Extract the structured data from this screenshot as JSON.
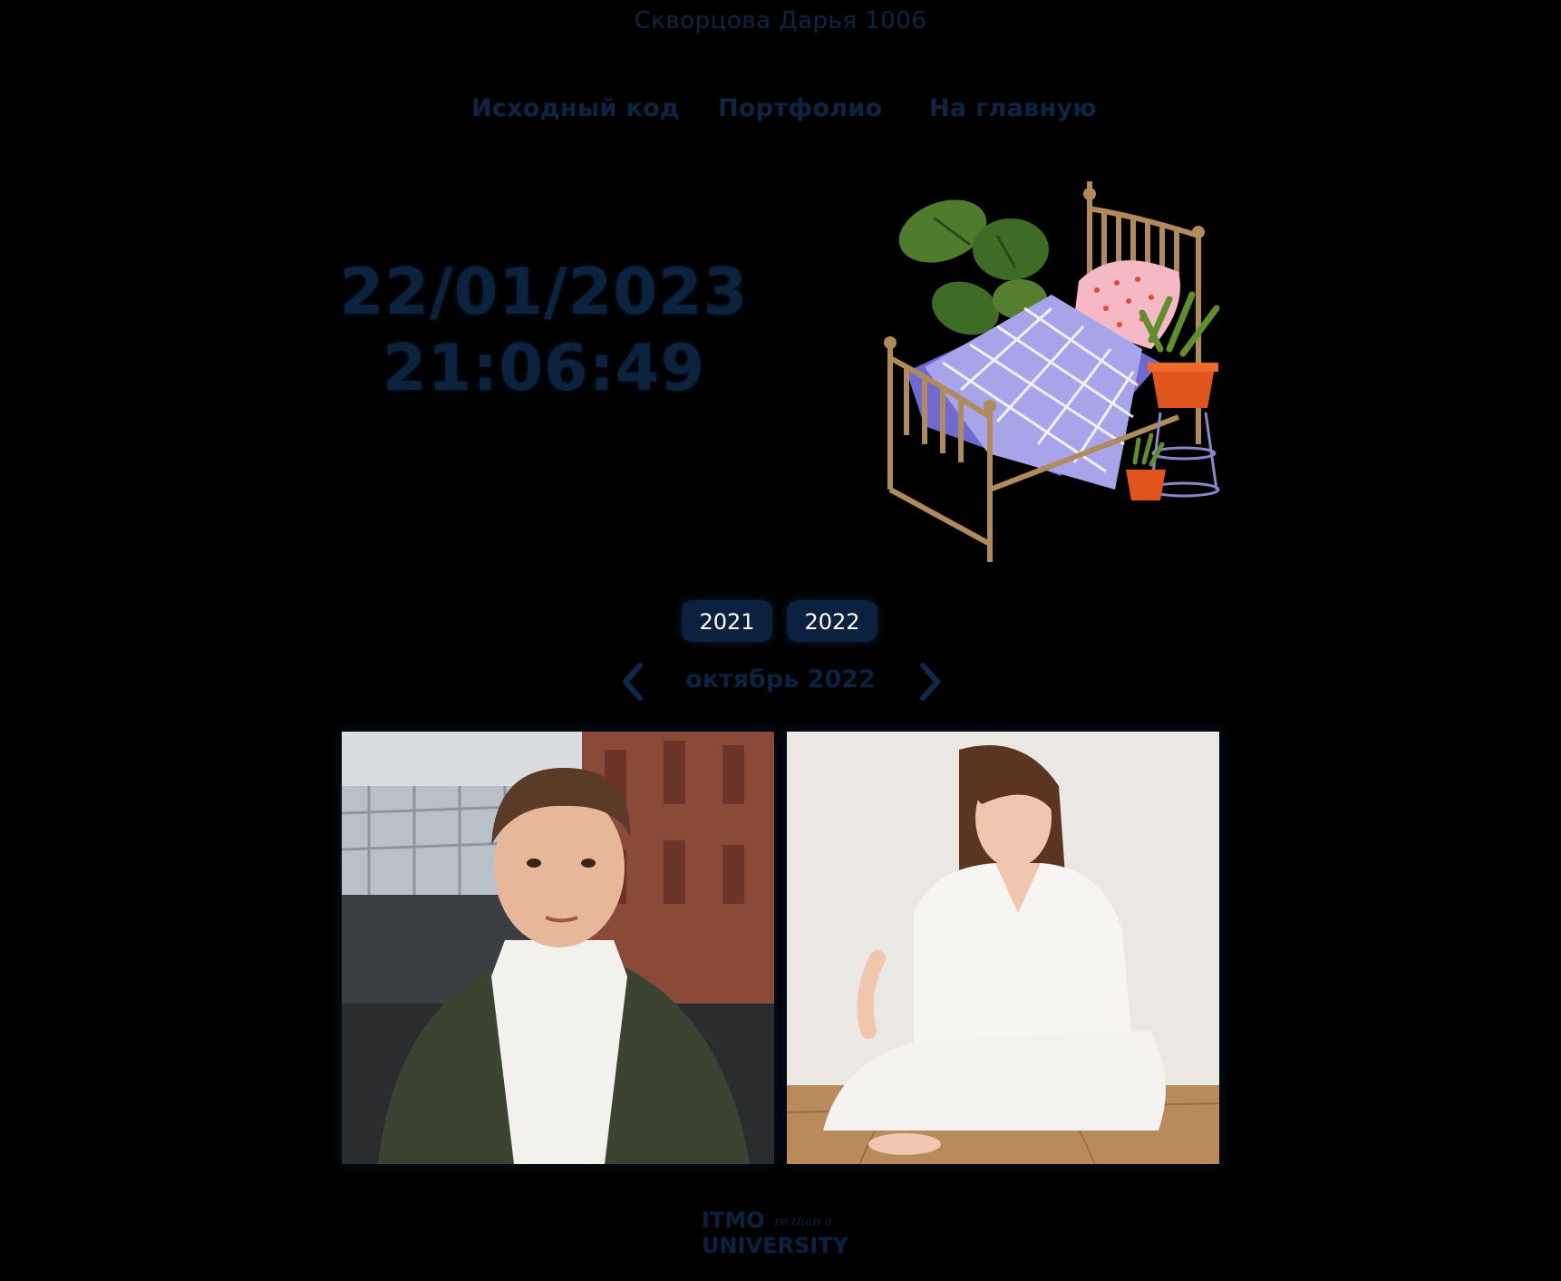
{
  "header": {
    "author": "Скворцова Дарья 1006"
  },
  "nav": {
    "items": [
      {
        "label": "Исходный код"
      },
      {
        "label": "Портфолио"
      },
      {
        "label": "На главную"
      }
    ]
  },
  "clock": {
    "date": "22/01/2023",
    "time": "21:06:49"
  },
  "illustration": {
    "icon": "bed-with-plants-illustration"
  },
  "years": {
    "items": [
      {
        "label": "2021"
      },
      {
        "label": "2022"
      }
    ]
  },
  "month_nav": {
    "label": "октябрь 2022",
    "prev_icon": "chevron-left-icon",
    "next_icon": "chevron-right-icon"
  },
  "gallery": {
    "photos": [
      {
        "subject": "young man in green puffer jacket and white turtleneck, brick building background"
      },
      {
        "subject": "young woman in white knit outfit sitting against white wall"
      }
    ]
  },
  "footer": {
    "logo_text_1": "ITMO",
    "logo_text_2": "UNIVERSITY",
    "logo_script": "re than a"
  },
  "colors": {
    "background": "#000000",
    "text_dark": "#0d2540",
    "button": "#0a2240"
  }
}
